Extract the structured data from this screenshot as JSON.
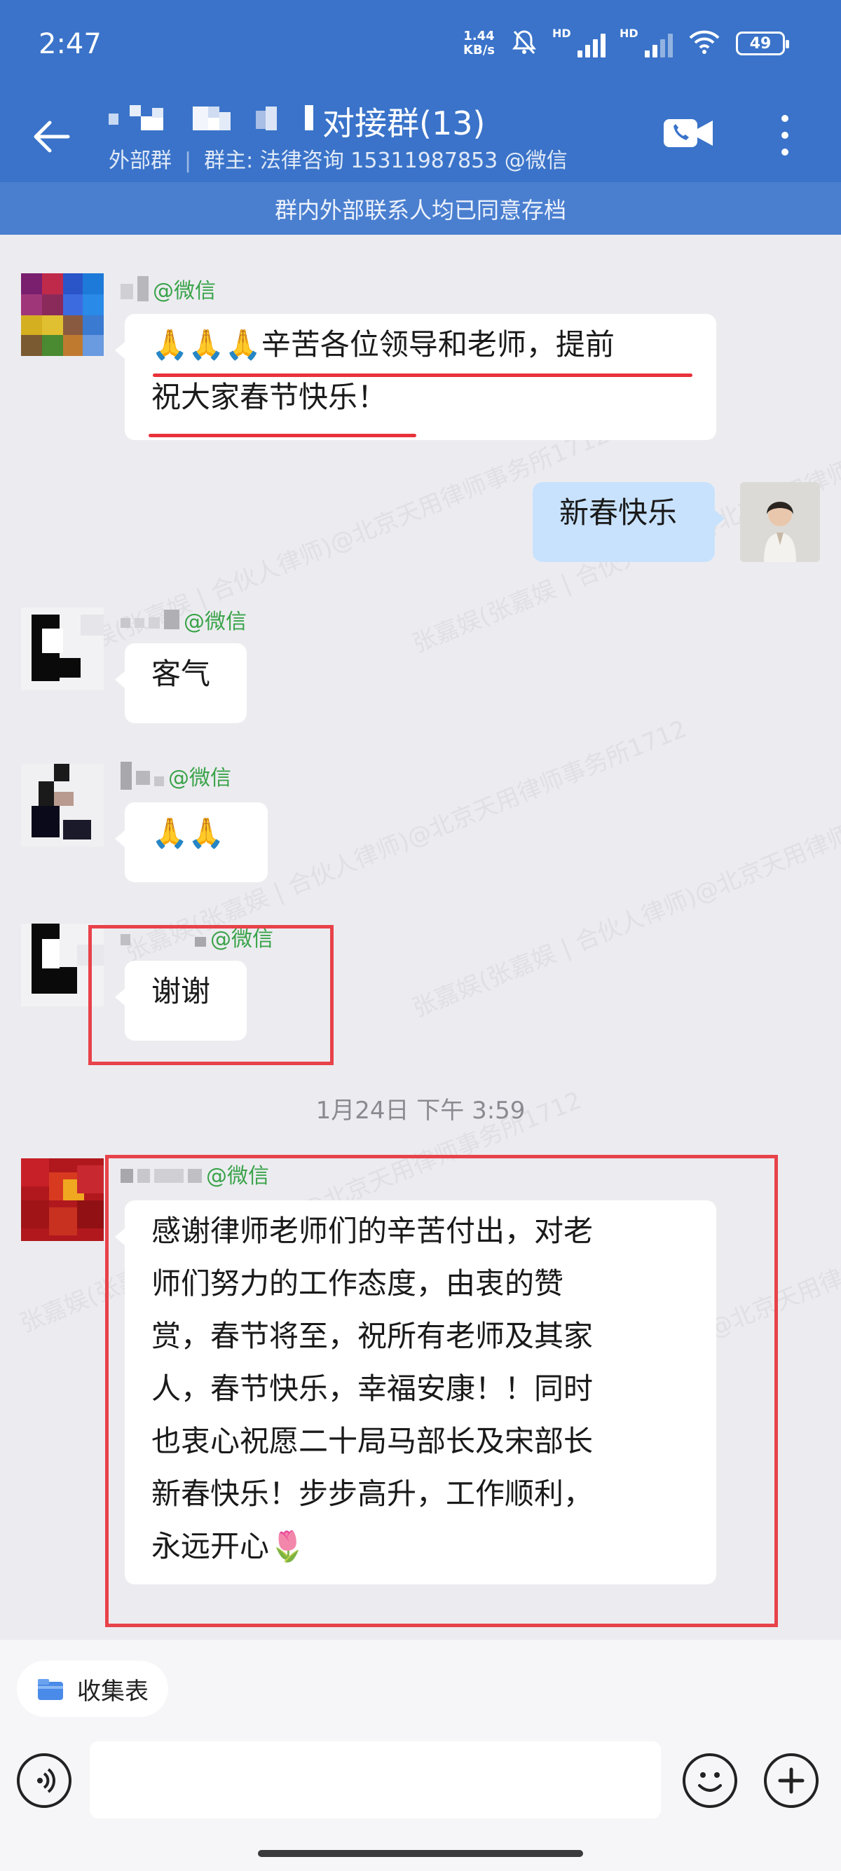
{
  "status_bar": {
    "time": "2:47",
    "net_speed_value": "1.44",
    "net_speed_unit": "KB/s",
    "sim1_label": "HD",
    "sim2_label": "HD",
    "battery": "49"
  },
  "header": {
    "title": "对接群(13)",
    "external_tag": "外部群",
    "owner": "群主: 法律咨询 15311987853 @微信",
    "accent_color": "#3a73c9"
  },
  "notice": "群内外部联系人均已同意存档",
  "messages": [
    {
      "sender_tag": "@微信",
      "text_line1": "🙏🙏🙏辛苦各位领导和老师，提前",
      "text_line2": "祝大家春节快乐！"
    },
    {
      "sender": "me",
      "text": "新春快乐"
    },
    {
      "sender_tag": "@微信",
      "text": "客气"
    },
    {
      "sender_tag": "@微信",
      "text": "🙏🙏"
    },
    {
      "sender_tag": "@微信",
      "text": "谢谢"
    },
    {
      "sender_tag": "@微信",
      "lines": [
        "感谢律师老师们的辛苦付出，对老",
        "师们努力的工作态度，由衷的赞",
        "赏，春节将至，祝所有老师及其家",
        "人，春节快乐，幸福安康！！同时",
        "也衷心祝愿二十局马部长及宋部长",
        "新春快乐！步步高升，工作顺利，",
        "永远开心🌷"
      ]
    }
  ],
  "timestamp": "1月24日  下午 3:59",
  "watermark_text": "张嘉娱(张嘉娱 | 合伙人律师)@北京天用律师事务所1712",
  "footer": {
    "quick_chip_label": "收集表",
    "input_placeholder": ""
  },
  "highlight_color": "#e8424a"
}
